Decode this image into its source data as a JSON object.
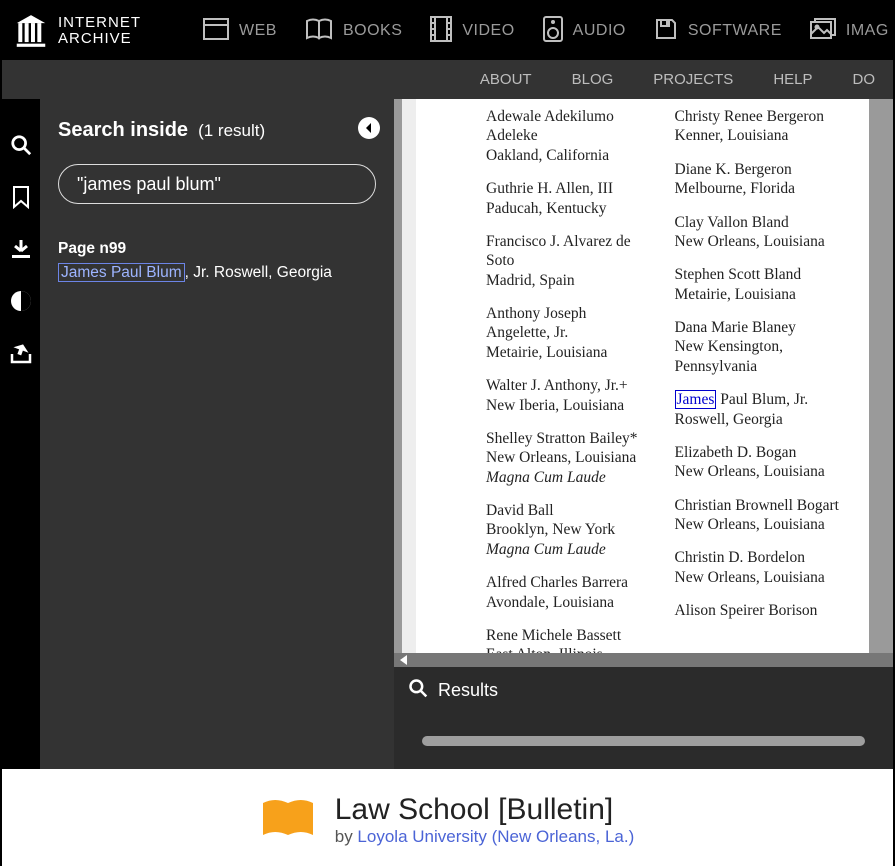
{
  "topnav": {
    "brand_line1": "INTERNET",
    "brand_line2": "ARCHIVE",
    "items": [
      "WEB",
      "BOOKS",
      "VIDEO",
      "AUDIO",
      "SOFTWARE",
      "IMAG"
    ]
  },
  "subnav": [
    "ABOUT",
    "BLOG",
    "PROJECTS",
    "HELP",
    "DO"
  ],
  "side_panel": {
    "title": "Search inside",
    "count": "(1 result)",
    "query": "\"james paul blum\"",
    "result": {
      "page_label": "Page n99",
      "highlight": "James Paul Blum",
      "rest": ", Jr. Roswell, Georgia"
    }
  },
  "results_bar": {
    "label": "Results"
  },
  "doc": {
    "title": "Law School [Bulletin]",
    "by_prefix": "by ",
    "publisher": "Loyola University (New Orleans, La.)"
  },
  "page_columns": {
    "left": [
      {
        "lines": [
          "Adewale Adekilumo Adeleke",
          "Oakland, California"
        ]
      },
      {
        "lines": [
          "Guthrie H. Allen, III",
          "Paducah, Kentucky"
        ]
      },
      {
        "lines": [
          "Francisco J. Alvarez de Soto",
          "Madrid, Spain"
        ]
      },
      {
        "lines": [
          "Anthony Joseph Angelette, Jr.",
          "Metairie, Louisiana"
        ]
      },
      {
        "lines": [
          "Walter J. Anthony, Jr.+",
          "New Iberia, Louisiana"
        ]
      },
      {
        "lines": [
          "Shelley Stratton Bailey*",
          "New Orleans, Louisiana"
        ],
        "honor": "Magna Cum Laude"
      },
      {
        "lines": [
          "David Ball",
          "Brooklyn, New York"
        ],
        "honor": "Magna Cum Laude"
      },
      {
        "lines": [
          "Alfred Charles Barrera",
          "Avondale, Louisiana"
        ]
      },
      {
        "lines": [
          "Rene Michele Bassett",
          "East Alton, Illinois"
        ]
      }
    ],
    "right": [
      {
        "lines": [
          "Christy Renee Bergeron",
          "Kenner, Louisiana"
        ]
      },
      {
        "lines": [
          "Diane K. Bergeron",
          "Melbourne, Florida"
        ]
      },
      {
        "lines": [
          "Clay Vallon Bland",
          "New Orleans, Louisiana"
        ]
      },
      {
        "lines": [
          "Stephen Scott Bland",
          "Metairie, Louisiana"
        ]
      },
      {
        "lines": [
          "Dana Marie Blaney",
          "New Kensington, Pennsylvania"
        ]
      },
      {
        "hl_first": "James",
        "rest_first": " Paul Blum, Jr.",
        "lines2": "Roswell, Georgia"
      },
      {
        "lines": [
          "Elizabeth D. Bogan",
          "New Orleans, Louisiana"
        ]
      },
      {
        "lines": [
          "Christian Brownell Bogart",
          "New Orleans, Louisiana"
        ]
      },
      {
        "lines": [
          "Christin D. Bordelon",
          "New Orleans, Louisiana"
        ]
      },
      {
        "lines": [
          "Alison Speirer Borison"
        ]
      }
    ]
  }
}
